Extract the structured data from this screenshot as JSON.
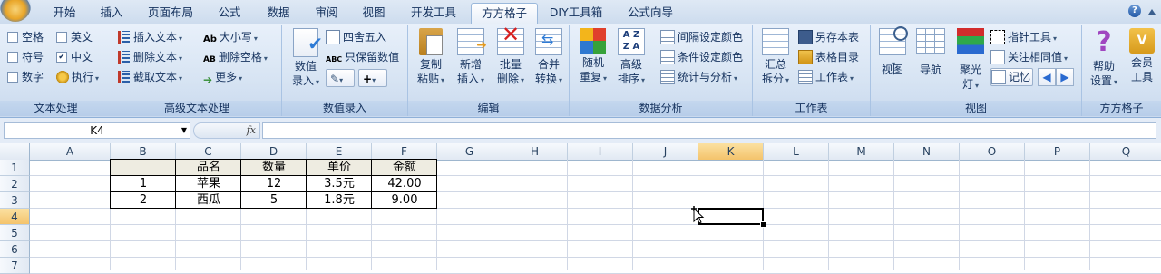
{
  "tabs": [
    "开始",
    "插入",
    "页面布局",
    "公式",
    "数据",
    "审阅",
    "视图",
    "开发工具",
    "方方格子",
    "DIY工具箱",
    "公式向导"
  ],
  "active_tab": "方方格子",
  "ribbon": {
    "text_processing": {
      "label": "文本处理",
      "checks": [
        {
          "label": "空格",
          "checked": false
        },
        {
          "label": "英文",
          "checked": false
        },
        {
          "label": "符号",
          "checked": false
        },
        {
          "label": "中文",
          "checked": true
        },
        {
          "label": "数字",
          "checked": false
        }
      ],
      "execute": "执行"
    },
    "advanced_text": {
      "label": "高级文本处理",
      "insert_text": "插入文本",
      "delete_text": "删除文本",
      "extract_text": "截取文本",
      "case": "大小写",
      "delete_space": "删除空格",
      "more": "更多"
    },
    "value_entry": {
      "label": "数值录入",
      "big": "数值\n录入",
      "round": "四舍五入",
      "keep_value": "只保留数值"
    },
    "edit": {
      "label": "编辑",
      "copy_paste": "复制\n粘贴",
      "new_insert": "新增\n插入",
      "batch_delete": "批量\n删除",
      "merge_convert": "合并\n转换"
    },
    "data_analysis": {
      "label": "数据分析",
      "random_repeat": "随机\n重复",
      "adv_sort": "高级\n排序",
      "interval_color": "间隔设定颜色",
      "cond_color": "条件设定颜色",
      "stats": "统计与分析"
    },
    "worksheet": {
      "label": "工作表",
      "summary_split": "汇总\n拆分",
      "save_sheet": "另存本表",
      "sheet_dir": "表格目录",
      "worksheet": "工作表"
    },
    "view": {
      "label": "视图",
      "view": "视图",
      "nav": "导航",
      "spotlight": "聚光\n灯",
      "pointer_tool": "指针工具",
      "focus_same": "关注相同值",
      "memo": "记忆"
    },
    "fangfang": {
      "label": "方方格子",
      "help_settings": "帮助\n设置",
      "member_tools": "会员\n工具"
    }
  },
  "formula_bar": {
    "name_box": "K4",
    "fx": "fx",
    "formula": ""
  },
  "columns": [
    "A",
    "B",
    "C",
    "D",
    "E",
    "F",
    "G",
    "H",
    "I",
    "J",
    "K",
    "L",
    "M",
    "N",
    "O",
    "P",
    "Q"
  ],
  "rows": [
    "1",
    "2",
    "3",
    "4",
    "5",
    "6",
    "7"
  ],
  "selected_cell": {
    "col": "K",
    "row": "4"
  },
  "table": {
    "headers": [
      "",
      "品名",
      "数量",
      "单价",
      "金额"
    ],
    "rows": [
      [
        "1",
        "苹果",
        "12",
        "3.5元",
        "42.00"
      ],
      [
        "2",
        "西瓜",
        "5",
        "1.8元",
        "9.00"
      ]
    ]
  },
  "colors": {
    "tab_active_border": "#9ab8db",
    "header_fill": "#eeece1",
    "selected_header": "#f4c36b"
  }
}
